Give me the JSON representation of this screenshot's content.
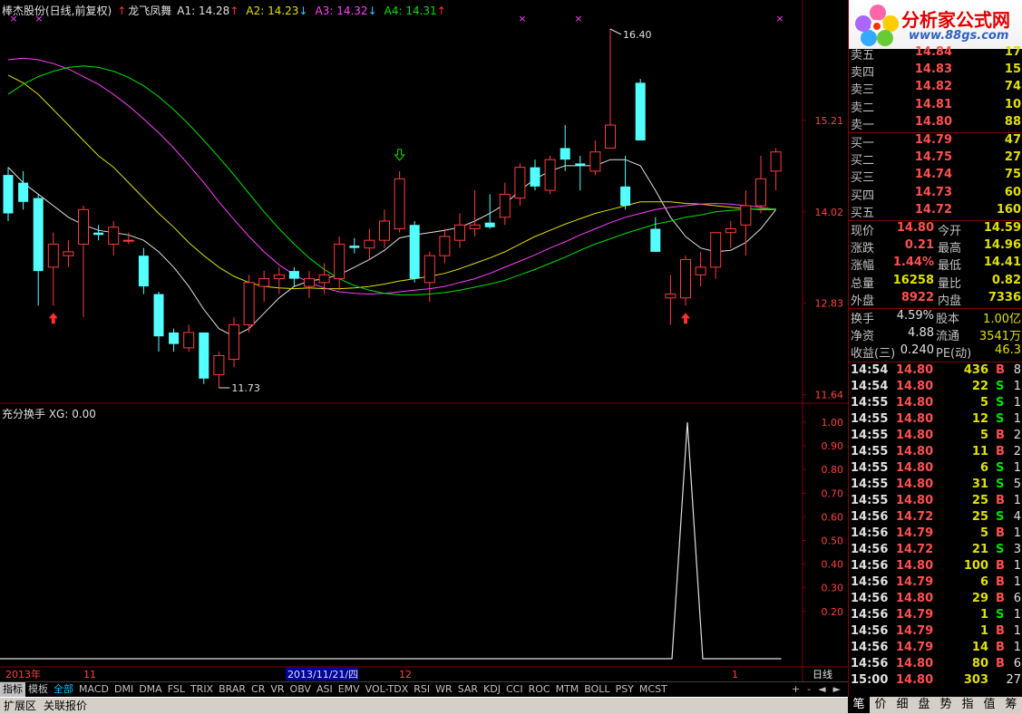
{
  "header": {
    "stock_name": "棒杰股份(日线,前复权)",
    "indicator_name": "龙飞凤舞",
    "a1": "A1: 14.28",
    "a2": "A2: 14.23",
    "a3": "A3: 14.32",
    "a4": "A4: 14.31",
    "colors": {
      "stock": "#e0e0e0",
      "indicator": "#e0e0e0",
      "a1": "#e0e0e0",
      "a2": "#e0e000",
      "a3": "#ff40ff",
      "a4": "#00e000"
    }
  },
  "price_axis": {
    "labels": [
      "15.21",
      "14.02",
      "12.83",
      "11.64"
    ]
  },
  "annotations": {
    "high": "16.40",
    "low": "11.73"
  },
  "sub_panel": {
    "title": "充分换手  XG: 0.00",
    "labels": [
      "1.00",
      "0.90",
      "0.80",
      "0.70",
      "0.60",
      "0.50",
      "0.40",
      "0.30",
      "0.20"
    ]
  },
  "date_axis": {
    "labels": [
      "2013年",
      "11",
      "2013/11/21/四",
      "12",
      "1"
    ],
    "period": "日线"
  },
  "chart_data": {
    "type": "candlestick",
    "price_range": [
      11.4,
      17.0
    ],
    "candles": [
      {
        "o": 14.5,
        "h": 14.6,
        "l": 13.9,
        "c": 14.0
      },
      {
        "o": 14.4,
        "h": 14.55,
        "l": 14.05,
        "c": 14.15
      },
      {
        "o": 14.2,
        "h": 14.25,
        "l": 12.8,
        "c": 13.25
      },
      {
        "o": 13.3,
        "h": 13.75,
        "l": 12.8,
        "c": 13.6
      },
      {
        "o": 13.45,
        "h": 13.65,
        "l": 13.3,
        "c": 13.5
      },
      {
        "o": 13.6,
        "h": 14.1,
        "l": 12.65,
        "c": 14.05
      },
      {
        "o": 13.75,
        "h": 13.85,
        "l": 13.65,
        "c": 13.72
      },
      {
        "o": 13.6,
        "h": 13.9,
        "l": 13.45,
        "c": 13.82
      },
      {
        "o": 13.65,
        "h": 13.75,
        "l": 13.6,
        "c": 13.65
      },
      {
        "o": 13.45,
        "h": 13.55,
        "l": 12.95,
        "c": 13.05
      },
      {
        "o": 12.95,
        "h": 12.98,
        "l": 12.2,
        "c": 12.4
      },
      {
        "o": 12.45,
        "h": 12.5,
        "l": 12.2,
        "c": 12.3
      },
      {
        "o": 12.25,
        "h": 12.55,
        "l": 12.2,
        "c": 12.45
      },
      {
        "o": 12.45,
        "h": 12.45,
        "l": 11.78,
        "c": 11.85
      },
      {
        "o": 11.9,
        "h": 12.2,
        "l": 11.73,
        "c": 12.15
      },
      {
        "o": 12.1,
        "h": 12.65,
        "l": 12.0,
        "c": 12.55
      },
      {
        "o": 12.55,
        "h": 13.2,
        "l": 12.45,
        "c": 13.1
      },
      {
        "o": 13.05,
        "h": 13.25,
        "l": 12.85,
        "c": 13.15
      },
      {
        "o": 13.15,
        "h": 13.3,
        "l": 12.95,
        "c": 13.2
      },
      {
        "o": 13.25,
        "h": 13.3,
        "l": 13.05,
        "c": 13.15
      },
      {
        "o": 13.05,
        "h": 13.25,
        "l": 12.9,
        "c": 13.15
      },
      {
        "o": 13.1,
        "h": 13.35,
        "l": 12.95,
        "c": 13.2
      },
      {
        "o": 13.15,
        "h": 13.7,
        "l": 13.0,
        "c": 13.6
      },
      {
        "o": 13.58,
        "h": 13.68,
        "l": 13.48,
        "c": 13.55
      },
      {
        "o": 13.55,
        "h": 13.8,
        "l": 13.4,
        "c": 13.65
      },
      {
        "o": 13.65,
        "h": 14.05,
        "l": 13.55,
        "c": 13.9
      },
      {
        "o": 13.8,
        "h": 14.55,
        "l": 13.75,
        "c": 14.45
      },
      {
        "o": 13.85,
        "h": 13.9,
        "l": 13.1,
        "c": 13.15
      },
      {
        "o": 13.1,
        "h": 13.5,
        "l": 12.85,
        "c": 13.45
      },
      {
        "o": 13.45,
        "h": 13.8,
        "l": 13.35,
        "c": 13.7
      },
      {
        "o": 13.65,
        "h": 14.0,
        "l": 13.55,
        "c": 13.85
      },
      {
        "o": 13.8,
        "h": 14.3,
        "l": 13.7,
        "c": 13.85
      },
      {
        "o": 13.88,
        "h": 14.25,
        "l": 13.8,
        "c": 13.82
      },
      {
        "o": 13.95,
        "h": 14.4,
        "l": 13.85,
        "c": 14.25
      },
      {
        "o": 14.2,
        "h": 14.65,
        "l": 14.1,
        "c": 14.6
      },
      {
        "o": 14.6,
        "h": 14.7,
        "l": 14.3,
        "c": 14.35
      },
      {
        "o": 14.3,
        "h": 14.75,
        "l": 14.25,
        "c": 14.7
      },
      {
        "o": 14.85,
        "h": 15.15,
        "l": 14.55,
        "c": 14.7
      },
      {
        "o": 14.65,
        "h": 14.75,
        "l": 14.3,
        "c": 14.62
      },
      {
        "o": 14.55,
        "h": 14.95,
        "l": 14.5,
        "c": 14.8
      },
      {
        "o": 14.85,
        "h": 16.4,
        "l": 14.85,
        "c": 15.15
      },
      {
        "o": 14.35,
        "h": 14.75,
        "l": 14.05,
        "c": 14.1
      },
      {
        "o": 15.7,
        "h": 15.75,
        "l": 14.95,
        "c": 14.95
      },
      {
        "o": 13.8,
        "h": 13.95,
        "l": 13.5,
        "c": 13.5
      },
      {
        "o": 12.9,
        "h": 13.2,
        "l": 12.55,
        "c": 12.95
      },
      {
        "o": 12.9,
        "h": 13.45,
        "l": 12.8,
        "c": 13.4
      },
      {
        "o": 13.2,
        "h": 13.5,
        "l": 13.05,
        "c": 13.3
      },
      {
        "o": 13.3,
        "h": 13.75,
        "l": 13.15,
        "c": 13.75
      },
      {
        "o": 13.75,
        "h": 13.9,
        "l": 13.55,
        "c": 13.8
      },
      {
        "o": 13.85,
        "h": 14.3,
        "l": 13.45,
        "c": 14.1
      },
      {
        "o": 14.1,
        "h": 14.75,
        "l": 14.0,
        "c": 14.45
      },
      {
        "o": 14.55,
        "h": 14.85,
        "l": 14.3,
        "c": 14.8
      }
    ],
    "signals": [
      {
        "index": 3,
        "type": "up"
      },
      {
        "index": 26,
        "type": "down"
      },
      {
        "index": 45,
        "type": "up"
      }
    ],
    "ma_lines": [
      {
        "name": "A1",
        "color": "#e0e0e0",
        "values": [
          14.6,
          14.4,
          14.25,
          14.1,
          13.95,
          13.85,
          13.78,
          13.75,
          13.72,
          13.65,
          13.5,
          13.3,
          13.05,
          12.75,
          12.5,
          12.4,
          12.5,
          12.7,
          12.9,
          13.05,
          13.12,
          13.15,
          13.2,
          13.3,
          13.4,
          13.52,
          13.68,
          13.72,
          13.75,
          13.78,
          13.82,
          13.9,
          14.0,
          14.12,
          14.3,
          14.45,
          14.55,
          14.62,
          14.62,
          14.62,
          14.7,
          14.7,
          14.62,
          14.3,
          13.95,
          13.7,
          13.55,
          13.5,
          13.52,
          13.62,
          13.8,
          14.05
        ]
      },
      {
        "name": "A2",
        "color": "#e0e000",
        "values": [
          15.8,
          15.7,
          15.55,
          15.35,
          15.15,
          14.95,
          14.75,
          14.6,
          14.4,
          14.2,
          14.0,
          13.82,
          13.62,
          13.45,
          13.3,
          13.18,
          13.1,
          13.05,
          13.03,
          13.02,
          13.03,
          13.02,
          13.02,
          13.03,
          13.05,
          13.08,
          13.12,
          13.15,
          13.18,
          13.22,
          13.28,
          13.35,
          13.42,
          13.5,
          13.6,
          13.7,
          13.78,
          13.86,
          13.93,
          14.0,
          14.05,
          14.1,
          14.15,
          14.15,
          14.15,
          14.13,
          14.12,
          14.1,
          14.08,
          14.06,
          14.05,
          14.05
        ]
      },
      {
        "name": "A3",
        "color": "#ff40ff",
        "values": [
          16.0,
          16.02,
          16.0,
          15.95,
          15.88,
          15.78,
          15.68,
          15.55,
          15.4,
          15.23,
          15.05,
          14.85,
          14.63,
          14.4,
          14.15,
          13.92,
          13.7,
          13.5,
          13.33,
          13.2,
          13.1,
          13.03,
          12.98,
          12.96,
          12.95,
          12.96,
          12.98,
          13.0,
          13.02,
          13.05,
          13.1,
          13.15,
          13.22,
          13.3,
          13.38,
          13.46,
          13.55,
          13.63,
          13.72,
          13.8,
          13.88,
          13.95,
          14.0,
          14.05,
          14.08,
          14.1,
          14.12,
          14.13,
          14.12,
          14.1,
          14.08,
          14.05
        ]
      },
      {
        "name": "A4",
        "color": "#00e000",
        "values": [
          15.55,
          15.68,
          15.78,
          15.85,
          15.9,
          15.92,
          15.9,
          15.85,
          15.77,
          15.66,
          15.52,
          15.35,
          15.16,
          14.95,
          14.73,
          14.5,
          14.26,
          14.02,
          13.8,
          13.6,
          13.42,
          13.27,
          13.15,
          13.06,
          13.0,
          12.96,
          12.94,
          12.94,
          12.95,
          12.97,
          13.0,
          13.04,
          13.08,
          13.13,
          13.2,
          13.27,
          13.35,
          13.43,
          13.52,
          13.6,
          13.67,
          13.74,
          13.8,
          13.86,
          13.9,
          13.95,
          13.98,
          14.02,
          14.04,
          14.05,
          14.06,
          14.06
        ]
      }
    ],
    "xg_series": {
      "name": "XG",
      "spike_index": 45,
      "spike_value": 1.0,
      "range": [
        0,
        1.05
      ]
    }
  },
  "quote": {
    "asks": [
      {
        "label": "卖五",
        "price": "14.84",
        "vol": "17"
      },
      {
        "label": "卖四",
        "price": "14.83",
        "vol": "15"
      },
      {
        "label": "卖三",
        "price": "14.82",
        "vol": "74"
      },
      {
        "label": "卖二",
        "price": "14.81",
        "vol": "10"
      },
      {
        "label": "卖一",
        "price": "14.80",
        "vol": "88"
      }
    ],
    "bids": [
      {
        "label": "买一",
        "price": "14.79",
        "vol": "47"
      },
      {
        "label": "买二",
        "price": "14.75",
        "vol": "27"
      },
      {
        "label": "买三",
        "price": "14.74",
        "vol": "75"
      },
      {
        "label": "买四",
        "price": "14.73",
        "vol": "60"
      },
      {
        "label": "买五",
        "price": "14.72",
        "vol": "160"
      }
    ],
    "stats": [
      {
        "l1": "现价",
        "v1": "14.80",
        "c1": "red",
        "l2": "今开",
        "v2": "14.59",
        "c2": "white"
      },
      {
        "l1": "涨跌",
        "v1": "0.21",
        "c1": "red",
        "l2": "最高",
        "v2": "14.96",
        "c2": "red"
      },
      {
        "l1": "涨幅",
        "v1": "1.44%",
        "c1": "red",
        "l2": "最低",
        "v2": "14.41",
        "c2": "green"
      },
      {
        "l1": "总量",
        "v1": "16258",
        "c1": "yellow",
        "l2": "量比",
        "v2": "0.82",
        "c2": "green"
      },
      {
        "l1": "外盘",
        "v1": "8922",
        "c1": "red",
        "l2": "内盘",
        "v2": "7336",
        "c2": "green"
      }
    ],
    "fund": [
      {
        "l1": "换手",
        "v1": "4.59%",
        "l2": "股本",
        "v2": "1.00亿"
      },
      {
        "l1": "净资",
        "v1": "4.88",
        "l2": "流通",
        "v2": "3541万"
      },
      {
        "l1": "收益(三)",
        "v1": "0.240",
        "l2": "PE(动)",
        "v2": "46.3"
      }
    ]
  },
  "ticks": [
    {
      "t": "14:54",
      "p": "14.80",
      "pc": "red",
      "v": "436",
      "bs": "B",
      "bc": "red",
      "n": "8"
    },
    {
      "t": "14:54",
      "p": "14.80",
      "pc": "red",
      "v": "22",
      "bs": "S",
      "bc": "green",
      "n": "1"
    },
    {
      "t": "14:55",
      "p": "14.80",
      "pc": "red",
      "v": "5",
      "bs": "S",
      "bc": "green",
      "n": "1"
    },
    {
      "t": "14:55",
      "p": "14.80",
      "pc": "red",
      "v": "12",
      "bs": "S",
      "bc": "green",
      "n": "1"
    },
    {
      "t": "14:55",
      "p": "14.80",
      "pc": "red",
      "v": "5",
      "bs": "B",
      "bc": "red",
      "n": "2"
    },
    {
      "t": "14:55",
      "p": "14.80",
      "pc": "red",
      "v": "11",
      "bs": "B",
      "bc": "red",
      "n": "2"
    },
    {
      "t": "14:55",
      "p": "14.80",
      "pc": "red",
      "v": "6",
      "bs": "S",
      "bc": "green",
      "n": "1"
    },
    {
      "t": "14:55",
      "p": "14.80",
      "pc": "red",
      "v": "31",
      "bs": "S",
      "bc": "green",
      "n": "5"
    },
    {
      "t": "14:55",
      "p": "14.80",
      "pc": "red",
      "v": "25",
      "bs": "B",
      "bc": "red",
      "n": "1"
    },
    {
      "t": "14:56",
      "p": "14.72",
      "pc": "red",
      "v": "25",
      "bs": "S",
      "bc": "green",
      "n": "4"
    },
    {
      "t": "14:56",
      "p": "14.79",
      "pc": "red",
      "v": "5",
      "bs": "B",
      "bc": "red",
      "n": "1"
    },
    {
      "t": "14:56",
      "p": "14.72",
      "pc": "red",
      "v": "21",
      "bs": "S",
      "bc": "green",
      "n": "3"
    },
    {
      "t": "14:56",
      "p": "14.80",
      "pc": "red",
      "v": "100",
      "bs": "B",
      "bc": "red",
      "n": "1"
    },
    {
      "t": "14:56",
      "p": "14.79",
      "pc": "red",
      "v": "6",
      "bs": "B",
      "bc": "red",
      "n": "1"
    },
    {
      "t": "14:56",
      "p": "14.80",
      "pc": "red",
      "v": "29",
      "bs": "B",
      "bc": "red",
      "n": "6"
    },
    {
      "t": "14:56",
      "p": "14.79",
      "pc": "red",
      "v": "1",
      "bs": "S",
      "bc": "green",
      "n": "1"
    },
    {
      "t": "14:56",
      "p": "14.79",
      "pc": "red",
      "v": "1",
      "bs": "B",
      "bc": "red",
      "n": "1"
    },
    {
      "t": "14:56",
      "p": "14.79",
      "pc": "red",
      "v": "14",
      "bs": "B",
      "bc": "red",
      "n": "1"
    },
    {
      "t": "14:56",
      "p": "14.80",
      "pc": "red",
      "v": "80",
      "bs": "B",
      "bc": "red",
      "n": "6"
    },
    {
      "t": "15:00",
      "p": "14.80",
      "pc": "red",
      "v": "303",
      "bs": "",
      "bc": "red",
      "n": "27"
    }
  ],
  "logo": {
    "title": "分析家公式网",
    "url": "www.88gs.com"
  },
  "tabs": [
    "指标",
    "模板",
    "全部",
    "MACD",
    "DMI",
    "DMA",
    "FSL",
    "TRIX",
    "BRAR",
    "CR",
    "VR",
    "OBV",
    "ASI",
    "EMV",
    "VOL-TDX",
    "RSI",
    "WR",
    "SAR",
    "KDJ",
    "CCI",
    "ROC",
    "MTM",
    "BOLL",
    "PSY",
    "MCST"
  ],
  "tab_controls": [
    "+",
    "-",
    "◄",
    "►"
  ],
  "bottom_tabs": [
    "扩展区",
    "关联报价"
  ],
  "right_tabs": [
    "笔",
    "价",
    "细",
    "盘",
    "势",
    "指",
    "值",
    "筹"
  ]
}
